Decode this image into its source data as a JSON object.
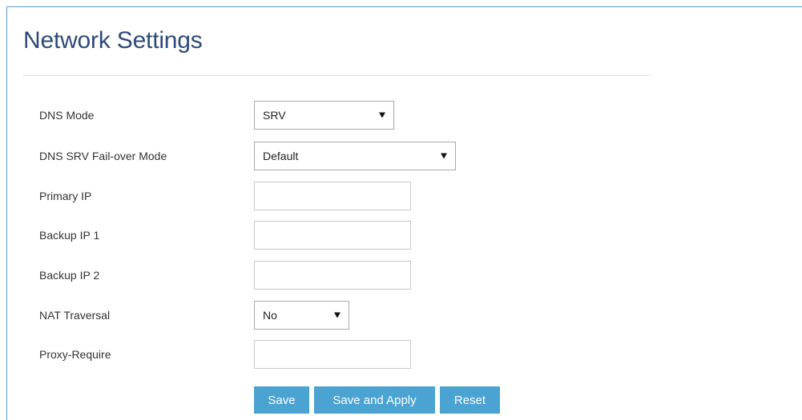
{
  "page": {
    "title": "Network Settings"
  },
  "form": {
    "dns_mode": {
      "label": "DNS Mode",
      "value": "SRV"
    },
    "dns_srv_failover_mode": {
      "label": "DNS SRV Fail-over Mode",
      "value": "Default"
    },
    "primary_ip": {
      "label": "Primary IP",
      "value": ""
    },
    "backup_ip_1": {
      "label": "Backup IP 1",
      "value": ""
    },
    "backup_ip_2": {
      "label": "Backup IP 2",
      "value": ""
    },
    "nat_traversal": {
      "label": "NAT Traversal",
      "value": "No"
    },
    "proxy_require": {
      "label": "Proxy-Require",
      "value": ""
    }
  },
  "buttons": {
    "save": "Save",
    "save_and_apply": "Save and Apply",
    "reset": "Reset"
  },
  "colors": {
    "title": "#2e4a7a",
    "button_bg": "#4aa3d1",
    "frame_border": "#5b9bd5"
  },
  "icons": {
    "select_arrow": "triangle-down-icon"
  }
}
